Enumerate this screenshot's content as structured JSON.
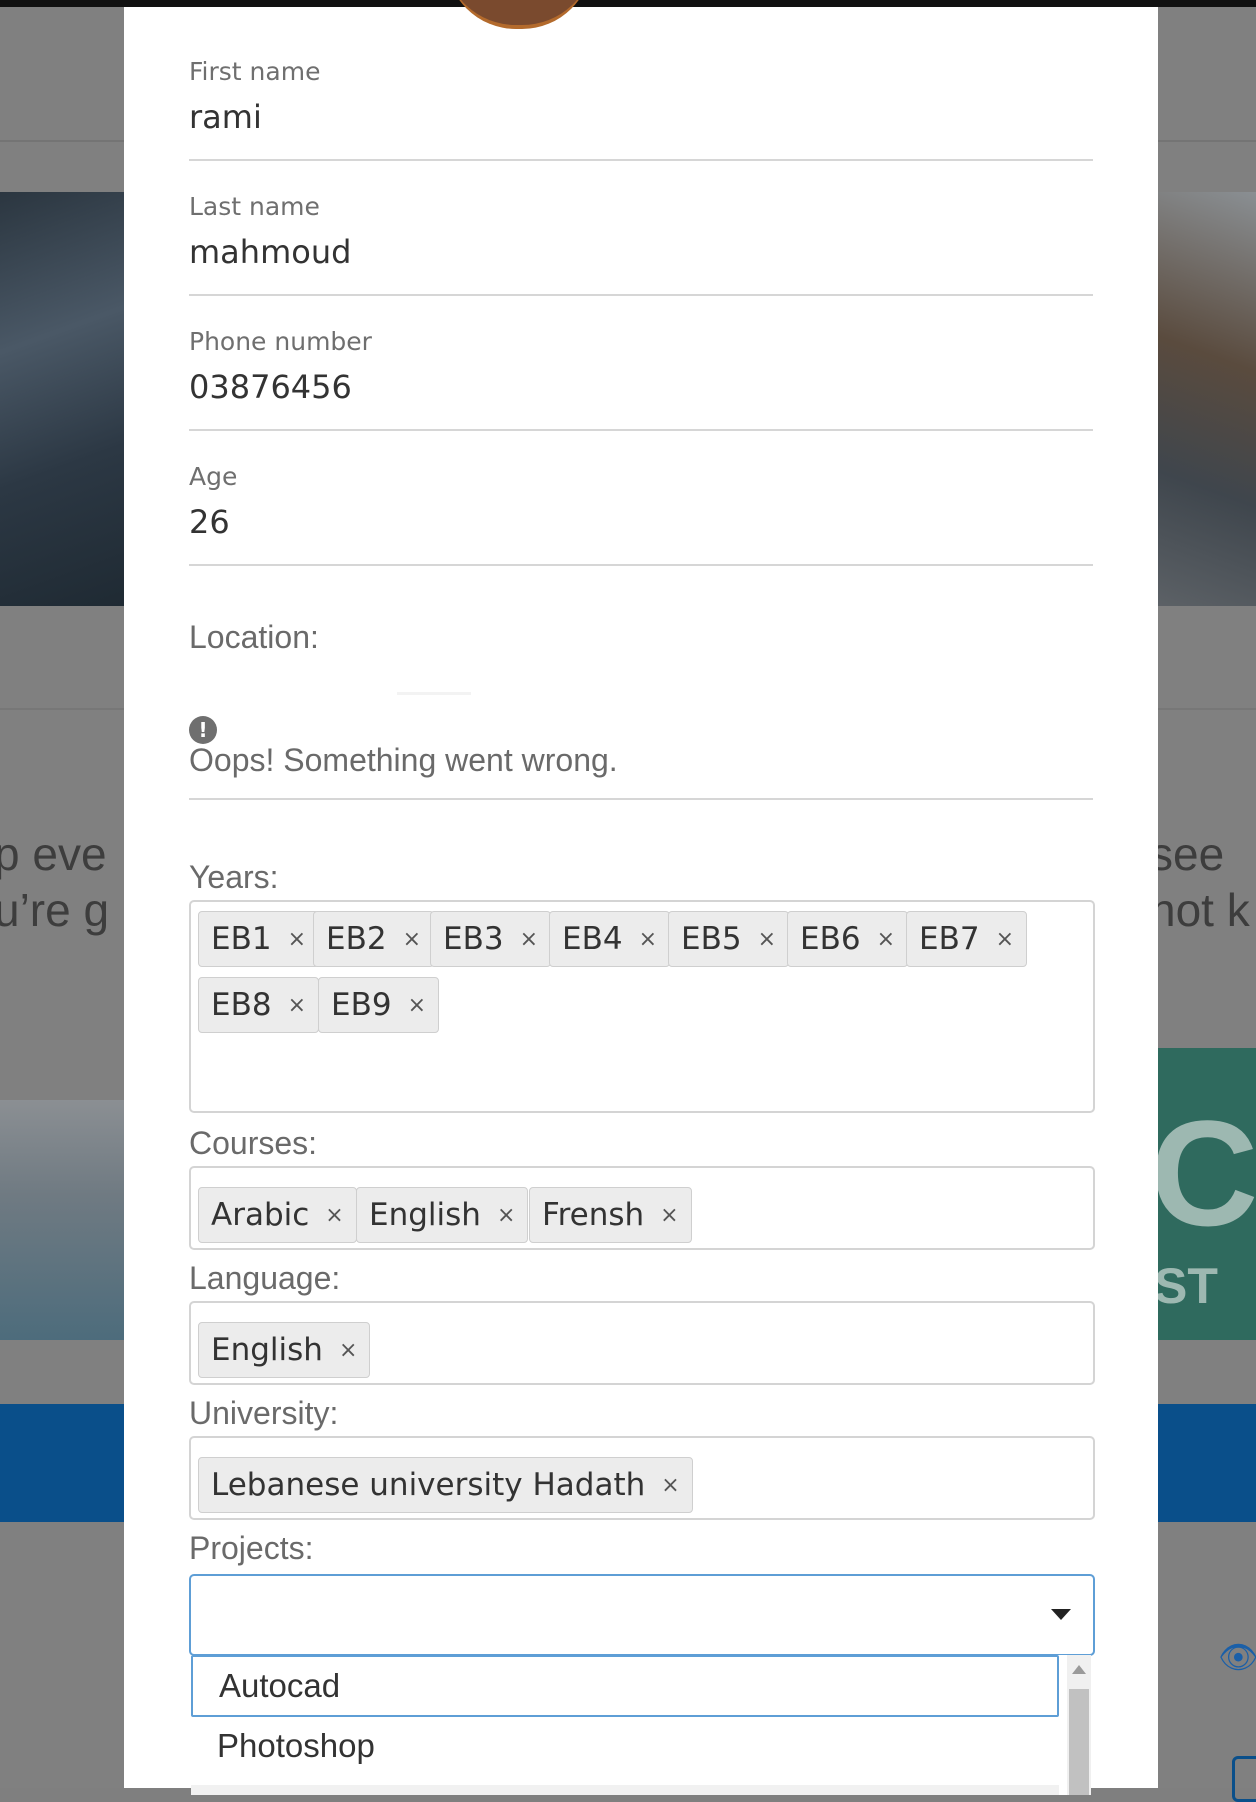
{
  "background": {
    "left_text_lines": [
      "p eve",
      "u’re g"
    ],
    "right_text_lines": [
      "see",
      "not k"
    ],
    "teal_big": "CH",
    "teal_small": "ST"
  },
  "form": {
    "first_name": {
      "label": "First name",
      "value": "rami"
    },
    "last_name": {
      "label": "Last name",
      "value": "mahmoud"
    },
    "phone": {
      "label": "Phone number",
      "value": "03876456"
    },
    "age": {
      "label": "Age",
      "value": "26"
    },
    "location": {
      "label": "Location:",
      "error_icon": "!",
      "error": "Oops! Something went wrong."
    },
    "years": {
      "label": "Years:",
      "tags": [
        "EB1",
        "EB2",
        "EB3",
        "EB4",
        "EB5",
        "EB6",
        "EB7",
        "EB8",
        "EB9"
      ]
    },
    "courses": {
      "label": "Courses:",
      "tags": [
        "Arabic",
        "English",
        "Frensh"
      ]
    },
    "language": {
      "label": "Language:",
      "tags": [
        "English"
      ]
    },
    "university": {
      "label": "University:",
      "tags": [
        "Lebanese university Hadath"
      ]
    },
    "projects": {
      "label": "Projects:",
      "value": "",
      "options": [
        "Autocad",
        "Photoshop"
      ]
    },
    "remove_glyph": "×"
  },
  "colors": {
    "focus_border": "#5e9ed6",
    "tag_bg": "#ececec",
    "overlay": "#808080"
  }
}
